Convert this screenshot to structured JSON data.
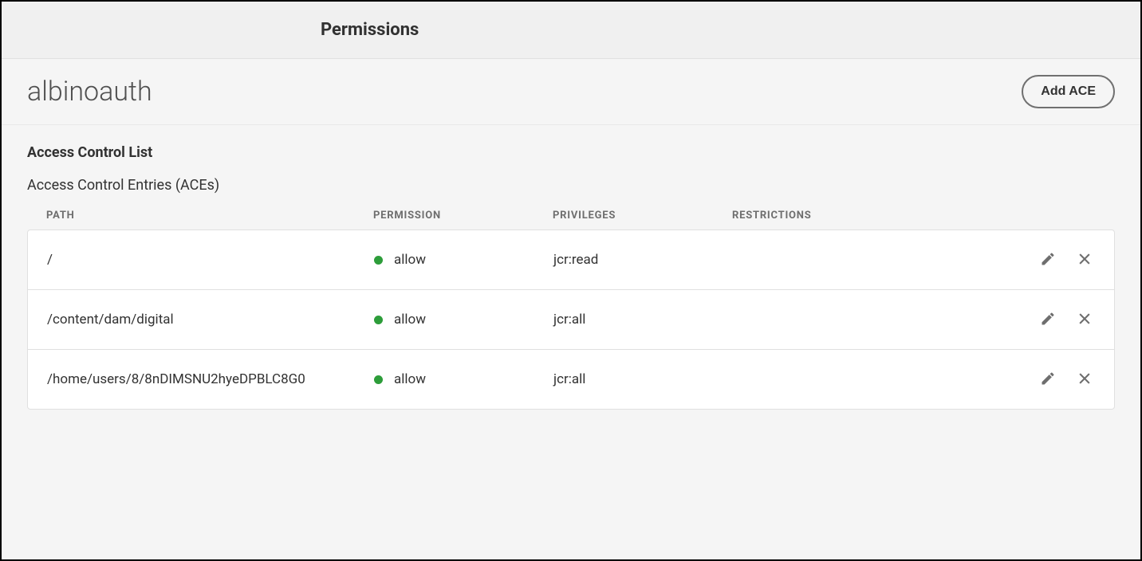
{
  "header": {
    "title": "Permissions"
  },
  "subheader": {
    "principal": "albinoauth",
    "addButton": "Add ACE"
  },
  "acl": {
    "sectionTitle": "Access Control List",
    "subTitle": "Access Control Entries (ACEs)",
    "columns": {
      "path": "PATH",
      "permission": "PERMISSION",
      "privileges": "PRIVILEGES",
      "restrictions": "RESTRICTIONS"
    },
    "entries": [
      {
        "path": "/",
        "permission": "allow",
        "statusColor": "#2d9d3a",
        "privileges": "jcr:read",
        "restrictions": ""
      },
      {
        "path": "/content/dam/digital",
        "permission": "allow",
        "statusColor": "#2d9d3a",
        "privileges": "jcr:all",
        "restrictions": ""
      },
      {
        "path": "/home/users/8/8nDIMSNU2hyeDPBLC8G0",
        "permission": "allow",
        "statusColor": "#2d9d3a",
        "privileges": "jcr:all",
        "restrictions": ""
      }
    ]
  }
}
